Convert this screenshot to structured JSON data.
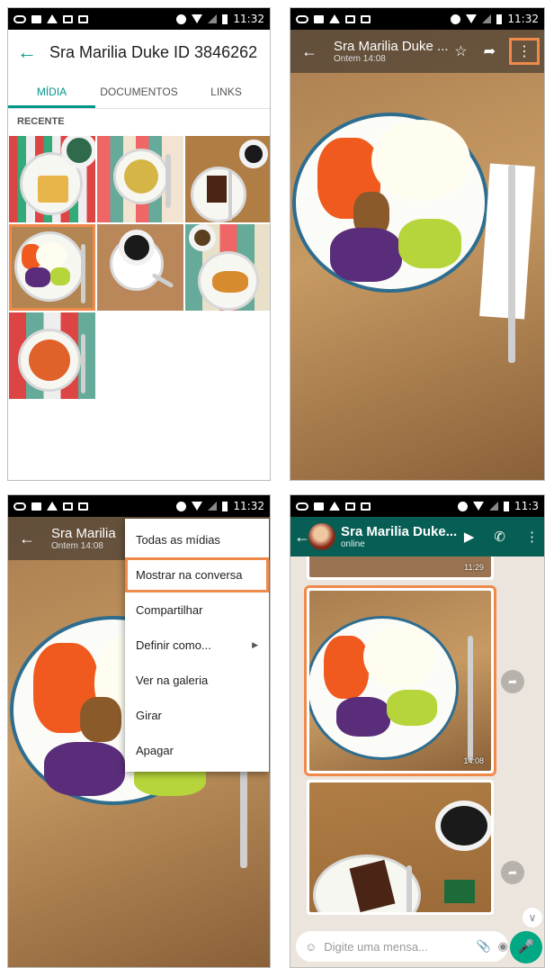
{
  "status_bar": {
    "time": "11:32"
  },
  "screen1": {
    "title": "Sra Marilia Duke ID 3846262",
    "tabs": [
      "MÍDIA",
      "DOCUMENTOS",
      "LINKS"
    ],
    "section_label": "RECENTE",
    "thumbnails": [
      "toast",
      "soup",
      "cake-coffee",
      "salad-bowl",
      "coffee-cup",
      "croissant",
      "pasta"
    ],
    "selected_thumbnail": 3
  },
  "screen2": {
    "title": "Sra Marilia Duke ...",
    "subtitle": "Ontem 14:08",
    "icons": [
      "star-icon",
      "share-icon",
      "more-icon"
    ],
    "time": "11:32"
  },
  "screen3": {
    "title": "Sra Marilia",
    "subtitle": "Ontem 14:08",
    "menu_items": [
      "Todas as mídias",
      "Mostrar na conversa",
      "Compartilhar",
      "Definir como...",
      "Ver na galeria",
      "Girar",
      "Apagar"
    ],
    "selected_item": 1
  },
  "screen4": {
    "title": "Sra Marilia Duke...",
    "subtitle": "online",
    "message_times": [
      "11:29",
      "14:08"
    ],
    "input_placeholder": "Digite uma mensa...",
    "time": "11:3"
  }
}
